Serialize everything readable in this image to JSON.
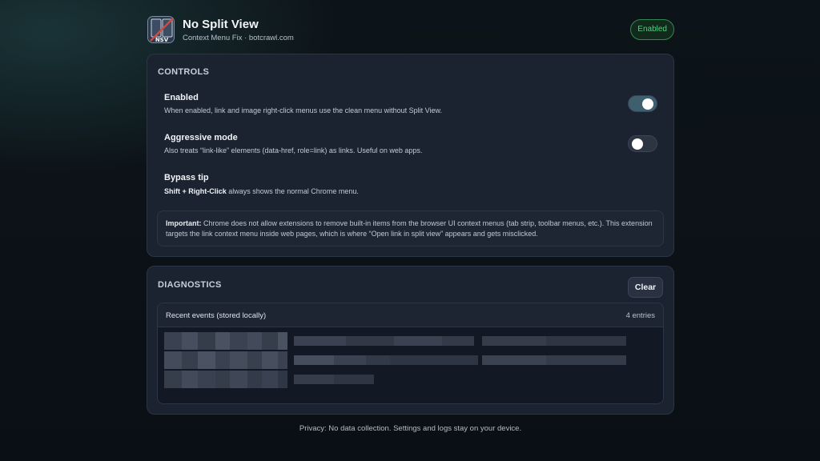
{
  "header": {
    "title": "No Split View",
    "subtitle": "Context Menu Fix · botcrawl.com",
    "logo_text": "NSV",
    "status": "Enabled"
  },
  "controls": {
    "section_title": "CONTROLS",
    "enabled": {
      "title": "Enabled",
      "desc": "When enabled, link and image right-click menus use the clean menu without Split View.",
      "checked": true
    },
    "aggressive": {
      "title": "Aggressive mode",
      "desc": "Also treats “link-like” elements (data-href, role=link) as links. Useful on web apps.",
      "checked": false
    },
    "bypass": {
      "title": "Bypass tip",
      "key": "Shift + Right-Click",
      "desc": " always shows the normal Chrome menu."
    },
    "note": {
      "label": "Important:",
      "text": " Chrome does not allow extensions to remove built-in items from the browser UI context menus (tab strip, toolbar menus, etc.). This extension targets the link context menu inside web pages, which is where “Open link in split view” appears and gets misclicked."
    }
  },
  "diagnostics": {
    "section_title": "DIAGNOSTICS",
    "clear_label": "Clear",
    "events_label": "Recent events (stored locally)",
    "events_count": "4 entries"
  },
  "footer": {
    "text": "Privacy: No data collection. Settings and logs stay on your device."
  },
  "colors": {
    "accent_green": "#4fd27f",
    "toggle_on": "#3e5f6e",
    "card_bg": "#1b2230"
  }
}
